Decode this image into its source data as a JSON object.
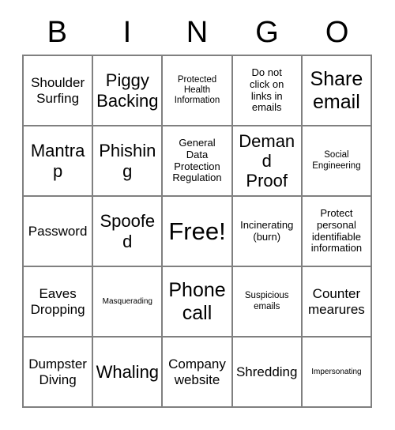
{
  "card": {
    "title_letters": [
      "B",
      "I",
      "N",
      "G",
      "O"
    ],
    "free_space_label": "Free!",
    "grid_line_color": "#808080",
    "background_color": "#ffffff",
    "text_color": "#000000",
    "rows": 5,
    "columns": 5,
    "cells": [
      [
        {
          "text": "Shoulder\nSurfing",
          "size": "lg"
        },
        {
          "text": "Piggy\nBacking",
          "size": "xl"
        },
        {
          "text": "Protected\nHealth\nInformation",
          "size": "sm"
        },
        {
          "text": "Do not\nclick on\nlinks in\nemails",
          "size": "md"
        },
        {
          "text": "Share\nemail",
          "size": "xxl"
        }
      ],
      [
        {
          "text": "Mantrap",
          "size": "xl"
        },
        {
          "text": "Phishing",
          "size": "xl"
        },
        {
          "text": "General\nData\nProtection\nRegulation",
          "size": "md"
        },
        {
          "text": "Demand\nProof",
          "size": "xl"
        },
        {
          "text": "Social\nEngineering",
          "size": "sm"
        }
      ],
      [
        {
          "text": "Password",
          "size": "lg"
        },
        {
          "text": "Spoofed",
          "size": "xl"
        },
        {
          "text": "Free!",
          "size": "free"
        },
        {
          "text": "Incinerating\n(burn)",
          "size": "md"
        },
        {
          "text": "Protect\npersonal\nidentifiable\ninformation",
          "size": "md"
        }
      ],
      [
        {
          "text": "Eaves\nDropping",
          "size": "lg"
        },
        {
          "text": "Masquerading",
          "size": "xs"
        },
        {
          "text": "Phone\ncall",
          "size": "xxl"
        },
        {
          "text": "Suspicious\nemails",
          "size": "sm"
        },
        {
          "text": "Counter\nmearures",
          "size": "lg"
        }
      ],
      [
        {
          "text": "Dumpster\nDiving",
          "size": "lg"
        },
        {
          "text": "Whaling",
          "size": "xl"
        },
        {
          "text": "Company\nwebsite",
          "size": "lg"
        },
        {
          "text": "Shredding",
          "size": "lg"
        },
        {
          "text": "Impersonating",
          "size": "xs"
        }
      ]
    ]
  }
}
